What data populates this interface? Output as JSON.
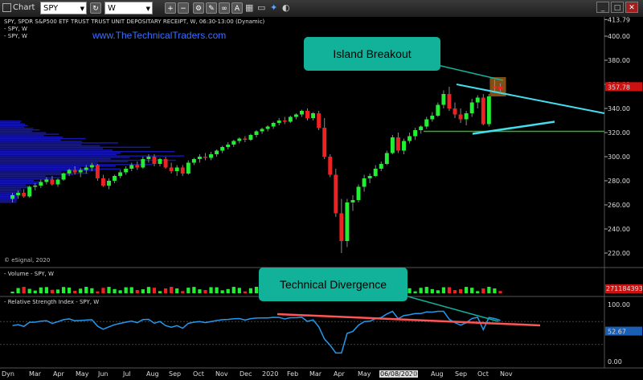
{
  "toolbar": {
    "chart_label": "Chart",
    "symbol": "SPY",
    "interval": "W"
  },
  "header": {
    "title": "SPY, SPDR S&P500 ETF TRUST TRUST UNIT DEPOSITARY RECEIPT, W, 06:30-13:00 (Dynamic)",
    "sub1": "- SPY, W",
    "sub2": "- SPY, W",
    "website": "www.TheTechnicalTraders.com"
  },
  "copyright": "© eSignal, 2020",
  "annotations": {
    "island": "Island Breakout",
    "divergence": "Technical Divergence"
  },
  "price_axis": {
    "ticks": [
      "413.79",
      "400.00",
      "380.00",
      "360.00",
      "340.00",
      "320.00",
      "300.00",
      "280.00",
      "260.00",
      "240.00",
      "220.00"
    ],
    "last_price": "357.78"
  },
  "volume": {
    "label": "- Volume - SPY, W",
    "last_value": "271184393"
  },
  "rsi": {
    "label": "- Relative Strength Index - SPY, W",
    "ticks": [
      "100.00",
      "0.00"
    ],
    "last_value": "52.67"
  },
  "x_axis": {
    "labels": [
      "Dyn",
      "Mar",
      "Apr",
      "May",
      "Jun",
      "Jul",
      "Aug",
      "Sep",
      "Oct",
      "Nov",
      "Dec",
      "2020",
      "Feb",
      "Mar",
      "Apr",
      "May",
      "06/08/2020",
      "Jul",
      "Aug",
      "Sep",
      "Oct",
      "Nov"
    ]
  },
  "colors": {
    "up": "#22ee33",
    "down": "#ee2222",
    "volume_profile": "#1a1acc",
    "cyan_trendline": "#44ddee",
    "support": "#22bb22",
    "rsi": "#2299ee",
    "divergence": "#ff5555",
    "callout": "#12b19a"
  },
  "chart_data": {
    "type": "candlestick",
    "ylim": [
      210,
      414
    ],
    "candles": [
      [
        265,
        270,
        262,
        268
      ],
      [
        268,
        272,
        265,
        270
      ],
      [
        270,
        273,
        266,
        267
      ],
      [
        267,
        276,
        266,
        275
      ],
      [
        275,
        278,
        272,
        276
      ],
      [
        276,
        281,
        274,
        279
      ],
      [
        279,
        283,
        277,
        281
      ],
      [
        281,
        284,
        276,
        277
      ],
      [
        277,
        282,
        275,
        281
      ],
      [
        281,
        287,
        280,
        286
      ],
      [
        286,
        290,
        284,
        289
      ],
      [
        289,
        292,
        285,
        287
      ],
      [
        287,
        291,
        283,
        289
      ],
      [
        289,
        293,
        286,
        291
      ],
      [
        291,
        295,
        288,
        293
      ],
      [
        293,
        294,
        280,
        282
      ],
      [
        282,
        285,
        275,
        276
      ],
      [
        276,
        282,
        273,
        280
      ],
      [
        280,
        285,
        278,
        284
      ],
      [
        284,
        289,
        282,
        287
      ],
      [
        287,
        292,
        285,
        290
      ],
      [
        290,
        295,
        288,
        293
      ],
      [
        293,
        296,
        289,
        291
      ],
      [
        291,
        300,
        290,
        298
      ],
      [
        298,
        302,
        295,
        300
      ],
      [
        300,
        302,
        292,
        294
      ],
      [
        294,
        299,
        292,
        298
      ],
      [
        298,
        300,
        290,
        291
      ],
      [
        291,
        295,
        286,
        288
      ],
      [
        288,
        293,
        284,
        291
      ],
      [
        291,
        293,
        284,
        286
      ],
      [
        286,
        297,
        285,
        295
      ],
      [
        295,
        299,
        293,
        298
      ],
      [
        298,
        302,
        295,
        300
      ],
      [
        300,
        303,
        297,
        299
      ],
      [
        299,
        304,
        297,
        302
      ],
      [
        302,
        306,
        300,
        305
      ],
      [
        305,
        309,
        303,
        308
      ],
      [
        308,
        312,
        306,
        310
      ],
      [
        310,
        314,
        308,
        313
      ],
      [
        313,
        316,
        311,
        315
      ],
      [
        315,
        317,
        312,
        314
      ],
      [
        314,
        319,
        313,
        318
      ],
      [
        318,
        322,
        316,
        321
      ],
      [
        321,
        324,
        319,
        323
      ],
      [
        323,
        326,
        321,
        325
      ],
      [
        325,
        329,
        323,
        328
      ],
      [
        328,
        332,
        326,
        330
      ],
      [
        330,
        333,
        327,
        329
      ],
      [
        329,
        334,
        328,
        333
      ],
      [
        333,
        336,
        331,
        335
      ],
      [
        335,
        339,
        333,
        338
      ],
      [
        338,
        340,
        330,
        332
      ],
      [
        332,
        337,
        330,
        336
      ],
      [
        336,
        338,
        322,
        324
      ],
      [
        324,
        332,
        298,
        300
      ],
      [
        300,
        302,
        283,
        285
      ],
      [
        285,
        290,
        250,
        253
      ],
      [
        253,
        265,
        220,
        230
      ],
      [
        230,
        265,
        225,
        262
      ],
      [
        262,
        268,
        255,
        264
      ],
      [
        264,
        277,
        262,
        275
      ],
      [
        275,
        285,
        271,
        282
      ],
      [
        282,
        286,
        278,
        284
      ],
      [
        284,
        293,
        283,
        290
      ],
      [
        290,
        296,
        288,
        294
      ],
      [
        294,
        305,
        293,
        303
      ],
      [
        303,
        318,
        302,
        316
      ],
      [
        316,
        320,
        303,
        305
      ],
      [
        305,
        315,
        302,
        313
      ],
      [
        313,
        320,
        311,
        317
      ],
      [
        317,
        324,
        314,
        322
      ],
      [
        322,
        326,
        319,
        325
      ],
      [
        325,
        333,
        323,
        331
      ],
      [
        331,
        337,
        329,
        334
      ],
      [
        334,
        345,
        333,
        343
      ],
      [
        343,
        355,
        340,
        352
      ],
      [
        352,
        358,
        338,
        340
      ],
      [
        340,
        345,
        332,
        335
      ],
      [
        335,
        340,
        328,
        331
      ],
      [
        331,
        338,
        326,
        336
      ],
      [
        336,
        348,
        333,
        345
      ],
      [
        345,
        351,
        340,
        349
      ],
      [
        349,
        352,
        326,
        327
      ],
      [
        327,
        352,
        325,
        350
      ],
      [
        358,
        364,
        353,
        358
      ],
      [
        358,
        361,
        354,
        356
      ]
    ]
  }
}
